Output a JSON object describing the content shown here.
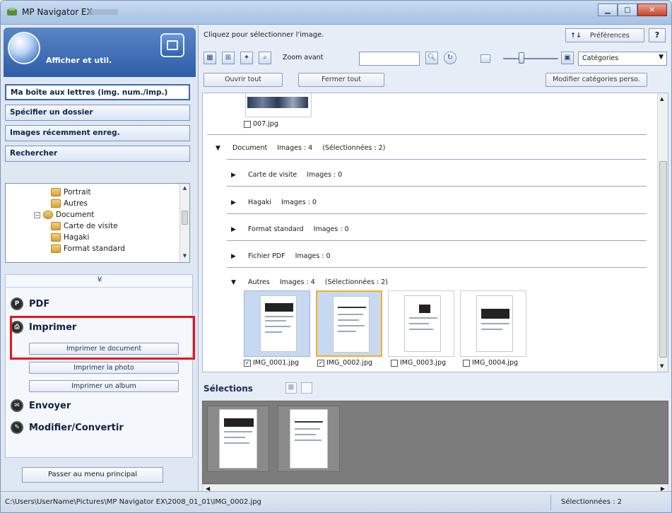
{
  "window": {
    "title": "MP Navigator EX"
  },
  "left": {
    "mode_title": "Afficher et util.",
    "nav": [
      "Ma boîte aux lettres (img. num./imp.)",
      "Spécifier un dossier",
      "Images récemment enreg.",
      "Rechercher"
    ],
    "tree": [
      {
        "label": "Portrait",
        "indent": 3
      },
      {
        "label": "Autres",
        "indent": 3
      },
      {
        "label": "Document",
        "indent": 1
      },
      {
        "label": "Carte de visite",
        "indent": 3
      },
      {
        "label": "Hagaki",
        "indent": 3
      },
      {
        "label": "Format standard",
        "indent": 3
      }
    ],
    "tasks": {
      "pdf": "PDF",
      "print": "Imprimer",
      "print_doc": "Imprimer le document",
      "print_photo": "Imprimer la photo",
      "print_album": "Imprimer un album",
      "send": "Envoyer",
      "edit": "Modifier/Convertir"
    },
    "back": "Passer au menu principal"
  },
  "right": {
    "hint": "Cliquez pour sélectionner l'image.",
    "preferences": "Préférences",
    "help": "?",
    "zoom_label": "Zoom avant",
    "category_select": "Catégories",
    "open_all": "Ouvrir tout",
    "close_all": "Fermer tout",
    "edit_categories": "Modifier catégories perso.",
    "top_image_caption": "007.jpg",
    "groups": {
      "document": {
        "name": "Document",
        "count": "Images : 4",
        "selected": "(Sélectionnées : 2)"
      },
      "carte": {
        "name": "Carte de visite",
        "count": "Images : 0"
      },
      "hagaki": {
        "name": "Hagaki",
        "count": "Images : 0"
      },
      "format": {
        "name": "Format standard",
        "count": "Images : 0"
      },
      "pdf": {
        "name": "Fichier PDF",
        "count": "Images : 0"
      },
      "autres": {
        "name": "Autres",
        "count": "Images : 4",
        "selected": "(Sélectionnées : 2)"
      }
    },
    "images": [
      {
        "name": "IMG_0001.jpg",
        "checked": true
      },
      {
        "name": "IMG_0002.jpg",
        "checked": true
      },
      {
        "name": "IMG_0003.jpg",
        "checked": false
      },
      {
        "name": "IMG_0004.jpg",
        "checked": false
      }
    ],
    "selections_title": "Sélections"
  },
  "status": {
    "path": "C:\\Users\\UserName\\Pictures\\MP Navigator EX\\2008_01_01\\IMG_0002.jpg",
    "selected": "Sélectionnées : 2"
  },
  "colors": {
    "highlight": "#e5161c",
    "current_border": "#f2b21b",
    "selected_bg": "#c7d9f2"
  }
}
